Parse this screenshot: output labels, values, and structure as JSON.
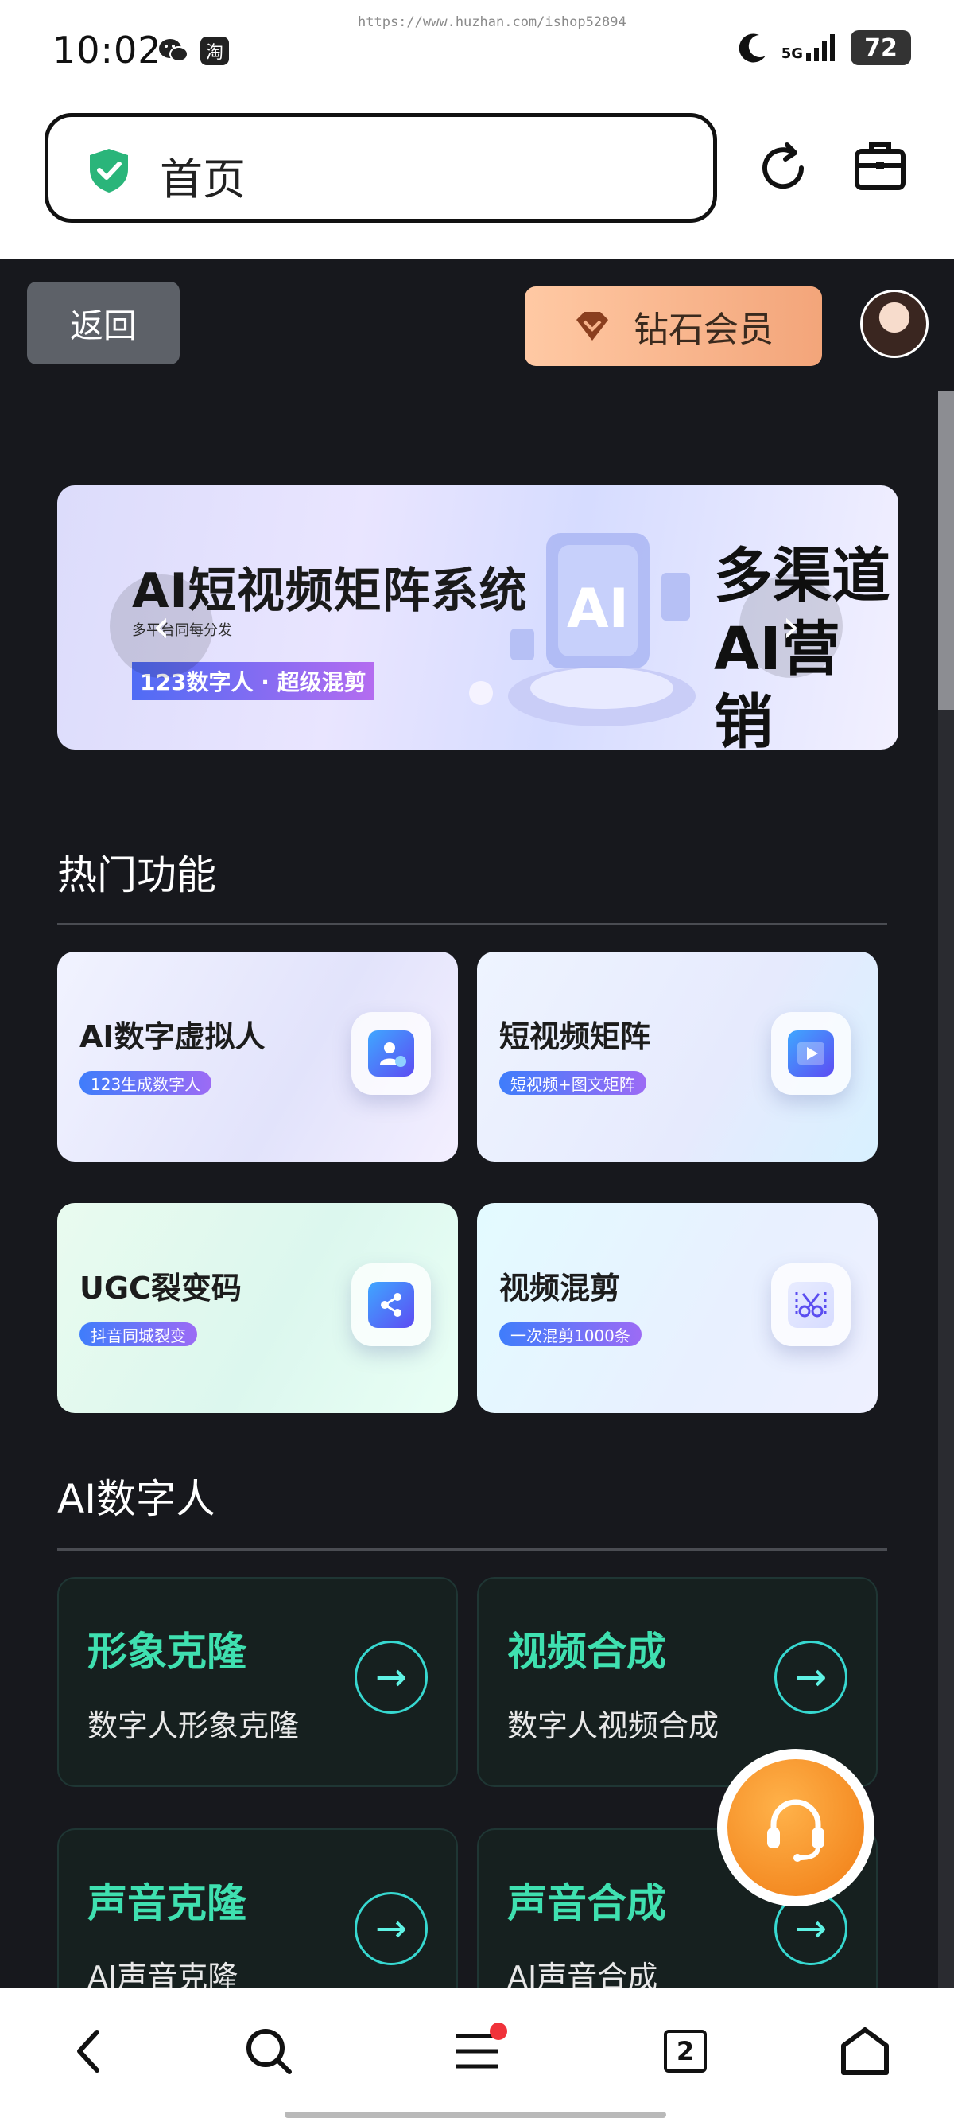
{
  "status_bar": {
    "time": "10:02",
    "watermark": "https://www.huzhan.com/ishop52894",
    "network": "5G",
    "battery": "72",
    "icons": [
      "wechat-icon",
      "taobao-icon",
      "moon-icon",
      "signal-icon"
    ]
  },
  "address_bar": {
    "text": "首页",
    "icons": [
      "shield-check-icon",
      "reload-icon",
      "toolbox-icon"
    ],
    "shield_color": "#2ab57a"
  },
  "header": {
    "back_label": "返回",
    "vip_label": "钻石会员"
  },
  "banner": {
    "title": "AI短视频矩阵系统",
    "subtitle": "多平台同每分发",
    "tag": "123数字人 · 超级混剪",
    "right_text_line1": "多渠道",
    "right_text_line2": "AI营销",
    "art_text": "AI"
  },
  "hot_section": {
    "title": "热门功能",
    "cards": [
      {
        "title": "AI数字虚拟人",
        "tag": "123生成数字人",
        "icon": "digital-human-icon"
      },
      {
        "title": "短视频矩阵",
        "tag": "短视频+图文矩阵",
        "icon": "video-play-icon"
      },
      {
        "title": "UGC裂变码",
        "tag": "抖音同城裂变",
        "icon": "share-icon"
      },
      {
        "title": "视频混剪",
        "tag": "一次混剪1000条",
        "icon": "scissors-icon"
      }
    ]
  },
  "ai_section": {
    "title": "AI数字人",
    "cards": [
      {
        "title": "形象克隆",
        "subtitle": "数字人形象克隆"
      },
      {
        "title": "视频合成",
        "subtitle": "数字人视频合成"
      },
      {
        "title": "声音克隆",
        "subtitle": "AI声音克隆"
      },
      {
        "title": "声音合成",
        "subtitle": "AI声音合成"
      }
    ]
  },
  "bottom_nav": {
    "items": [
      "back-icon",
      "search-icon",
      "menu-icon",
      "tabs-icon",
      "home-icon"
    ],
    "tabs_count": "2"
  },
  "colors": {
    "page_bg": "#17181d",
    "accent_green": "#3fe0b0",
    "vip_gradient": [
      "#ffc9a4",
      "#f3a57a"
    ],
    "notification_dot": "#f0323a"
  }
}
